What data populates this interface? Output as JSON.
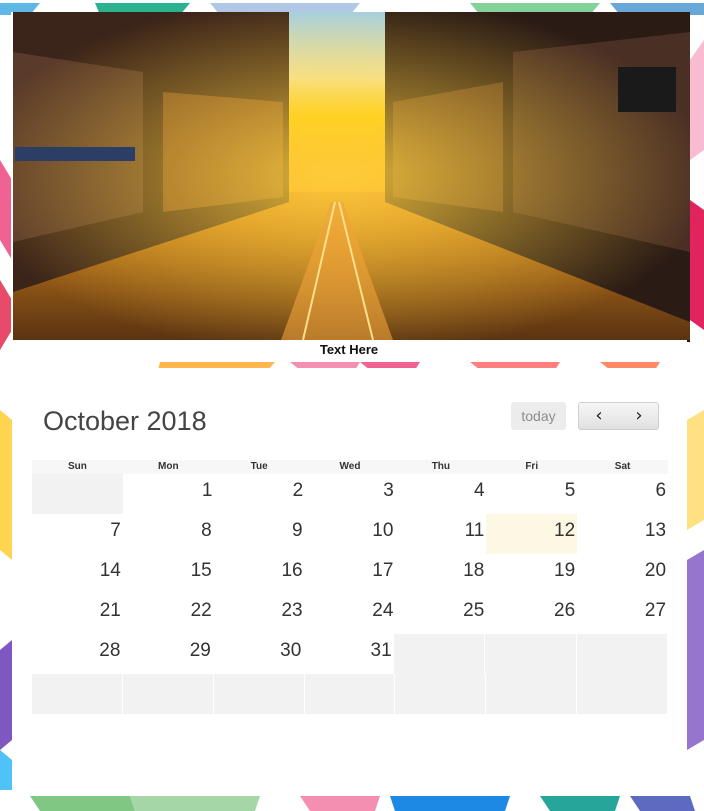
{
  "caption": "Text Here",
  "calendar": {
    "title": "October 2018",
    "today_label": "today",
    "prev_icon": "chevron-left-icon",
    "next_icon": "chevron-right-icon",
    "weekdays": [
      "Sun",
      "Mon",
      "Tue",
      "Wed",
      "Thu",
      "Fri",
      "Sat"
    ],
    "weeks": [
      [
        "",
        "1",
        "2",
        "3",
        "4",
        "5",
        "6"
      ],
      [
        "7",
        "8",
        "9",
        "10",
        "11",
        "12",
        "13"
      ],
      [
        "14",
        "15",
        "16",
        "17",
        "18",
        "19",
        "20"
      ],
      [
        "21",
        "22",
        "23",
        "24",
        "25",
        "26",
        "27"
      ],
      [
        "28",
        "29",
        "30",
        "31",
        "",
        "",
        ""
      ],
      [
        "",
        "",
        "",
        "",
        "",
        "",
        ""
      ]
    ],
    "today": "12"
  },
  "colors": {
    "today_highlight": "#fcf8e3",
    "empty_cell": "#f2f2f2",
    "title_text": "#444444"
  }
}
